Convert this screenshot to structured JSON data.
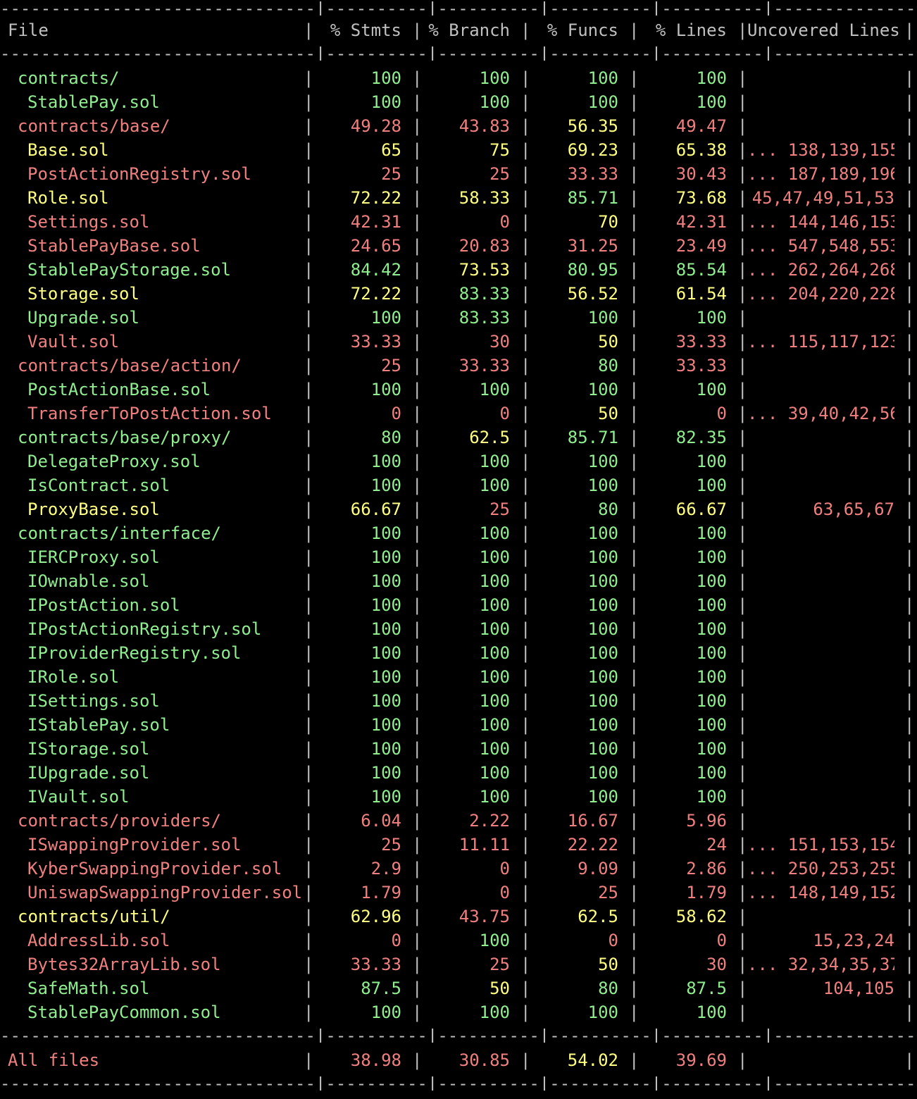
{
  "header": {
    "file": "File",
    "stmts": "% Stmts",
    "branch": "% Branch",
    "funcs": "% Funcs",
    "lines": "% Lines",
    "uncovered": "Uncovered Lines"
  },
  "separator_line": "-------------------------------|----------|----------|----------|----------|----------------|",
  "colors": {
    "green": "#90ee90",
    "red": "#f08080",
    "yellow": "#ffff80",
    "background": "#000000",
    "text": "#c0c0c0"
  },
  "rows": [
    {
      "name": "contracts/",
      "type": "dir",
      "file_color": "green",
      "stmts": "100",
      "stmts_color": "green",
      "branch": "100",
      "branch_color": "green",
      "funcs": "100",
      "funcs_color": "green",
      "lines": "100",
      "lines_color": "green",
      "uncovered": "",
      "uncovered_color": "red"
    },
    {
      "name": "StablePay.sol",
      "type": "file",
      "file_color": "green",
      "stmts": "100",
      "stmts_color": "green",
      "branch": "100",
      "branch_color": "green",
      "funcs": "100",
      "funcs_color": "green",
      "lines": "100",
      "lines_color": "green",
      "uncovered": "",
      "uncovered_color": "red"
    },
    {
      "name": "contracts/base/",
      "type": "dir",
      "file_color": "red",
      "stmts": "49.28",
      "stmts_color": "red",
      "branch": "43.83",
      "branch_color": "red",
      "funcs": "56.35",
      "funcs_color": "yellow",
      "lines": "49.47",
      "lines_color": "red",
      "uncovered": "",
      "uncovered_color": "red"
    },
    {
      "name": "Base.sol",
      "type": "file",
      "file_color": "yellow",
      "stmts": "65",
      "stmts_color": "yellow",
      "branch": "75",
      "branch_color": "yellow",
      "funcs": "69.23",
      "funcs_color": "yellow",
      "lines": "65.38",
      "lines_color": "yellow",
      "uncovered": "... 138,139,155",
      "uncovered_color": "red"
    },
    {
      "name": "PostActionRegistry.sol",
      "type": "file",
      "file_color": "red",
      "stmts": "25",
      "stmts_color": "red",
      "branch": "25",
      "branch_color": "red",
      "funcs": "33.33",
      "funcs_color": "red",
      "lines": "30.43",
      "lines_color": "red",
      "uncovered": "... 187,189,196",
      "uncovered_color": "red"
    },
    {
      "name": "Role.sol",
      "type": "file",
      "file_color": "yellow",
      "stmts": "72.22",
      "stmts_color": "yellow",
      "branch": "58.33",
      "branch_color": "yellow",
      "funcs": "85.71",
      "funcs_color": "green",
      "lines": "73.68",
      "lines_color": "yellow",
      "uncovered": "45,47,49,51,53",
      "uncovered_color": "red"
    },
    {
      "name": "Settings.sol",
      "type": "file",
      "file_color": "red",
      "stmts": "42.31",
      "stmts_color": "red",
      "branch": "0",
      "branch_color": "red",
      "funcs": "70",
      "funcs_color": "yellow",
      "lines": "42.31",
      "lines_color": "red",
      "uncovered": "... 144,146,153",
      "uncovered_color": "red"
    },
    {
      "name": "StablePayBase.sol",
      "type": "file",
      "file_color": "red",
      "stmts": "24.65",
      "stmts_color": "red",
      "branch": "20.83",
      "branch_color": "red",
      "funcs": "31.25",
      "funcs_color": "red",
      "lines": "23.49",
      "lines_color": "red",
      "uncovered": "... 547,548,553",
      "uncovered_color": "red"
    },
    {
      "name": "StablePayStorage.sol",
      "type": "file",
      "file_color": "green",
      "stmts": "84.42",
      "stmts_color": "green",
      "branch": "73.53",
      "branch_color": "yellow",
      "funcs": "80.95",
      "funcs_color": "green",
      "lines": "85.54",
      "lines_color": "green",
      "uncovered": "... 262,264,268",
      "uncovered_color": "red"
    },
    {
      "name": "Storage.sol",
      "type": "file",
      "file_color": "yellow",
      "stmts": "72.22",
      "stmts_color": "yellow",
      "branch": "83.33",
      "branch_color": "green",
      "funcs": "56.52",
      "funcs_color": "yellow",
      "lines": "61.54",
      "lines_color": "yellow",
      "uncovered": "... 204,220,228",
      "uncovered_color": "red"
    },
    {
      "name": "Upgrade.sol",
      "type": "file",
      "file_color": "green",
      "stmts": "100",
      "stmts_color": "green",
      "branch": "83.33",
      "branch_color": "green",
      "funcs": "100",
      "funcs_color": "green",
      "lines": "100",
      "lines_color": "green",
      "uncovered": "",
      "uncovered_color": "red"
    },
    {
      "name": "Vault.sol",
      "type": "file",
      "file_color": "red",
      "stmts": "33.33",
      "stmts_color": "red",
      "branch": "30",
      "branch_color": "red",
      "funcs": "50",
      "funcs_color": "yellow",
      "lines": "33.33",
      "lines_color": "red",
      "uncovered": "... 115,117,123",
      "uncovered_color": "red"
    },
    {
      "name": "contracts/base/action/",
      "type": "dir",
      "file_color": "red",
      "stmts": "25",
      "stmts_color": "red",
      "branch": "33.33",
      "branch_color": "red",
      "funcs": "80",
      "funcs_color": "green",
      "lines": "33.33",
      "lines_color": "red",
      "uncovered": "",
      "uncovered_color": "red"
    },
    {
      "name": "PostActionBase.sol",
      "type": "file",
      "file_color": "green",
      "stmts": "100",
      "stmts_color": "green",
      "branch": "100",
      "branch_color": "green",
      "funcs": "100",
      "funcs_color": "green",
      "lines": "100",
      "lines_color": "green",
      "uncovered": "",
      "uncovered_color": "red"
    },
    {
      "name": "TransferToPostAction.sol",
      "type": "file",
      "file_color": "red",
      "stmts": "0",
      "stmts_color": "red",
      "branch": "0",
      "branch_color": "red",
      "funcs": "50",
      "funcs_color": "yellow",
      "lines": "0",
      "lines_color": "red",
      "uncovered": "... 39,40,42,56",
      "uncovered_color": "red"
    },
    {
      "name": "contracts/base/proxy/",
      "type": "dir",
      "file_color": "green",
      "stmts": "80",
      "stmts_color": "green",
      "branch": "62.5",
      "branch_color": "yellow",
      "funcs": "85.71",
      "funcs_color": "green",
      "lines": "82.35",
      "lines_color": "green",
      "uncovered": "",
      "uncovered_color": "red"
    },
    {
      "name": "DelegateProxy.sol",
      "type": "file",
      "file_color": "green",
      "stmts": "100",
      "stmts_color": "green",
      "branch": "100",
      "branch_color": "green",
      "funcs": "100",
      "funcs_color": "green",
      "lines": "100",
      "lines_color": "green",
      "uncovered": "",
      "uncovered_color": "red"
    },
    {
      "name": "IsContract.sol",
      "type": "file",
      "file_color": "green",
      "stmts": "100",
      "stmts_color": "green",
      "branch": "100",
      "branch_color": "green",
      "funcs": "100",
      "funcs_color": "green",
      "lines": "100",
      "lines_color": "green",
      "uncovered": "",
      "uncovered_color": "red"
    },
    {
      "name": "ProxyBase.sol",
      "type": "file",
      "file_color": "yellow",
      "stmts": "66.67",
      "stmts_color": "yellow",
      "branch": "25",
      "branch_color": "red",
      "funcs": "80",
      "funcs_color": "green",
      "lines": "66.67",
      "lines_color": "yellow",
      "uncovered": "63,65,67",
      "uncovered_color": "red"
    },
    {
      "name": "contracts/interface/",
      "type": "dir",
      "file_color": "green",
      "stmts": "100",
      "stmts_color": "green",
      "branch": "100",
      "branch_color": "green",
      "funcs": "100",
      "funcs_color": "green",
      "lines": "100",
      "lines_color": "green",
      "uncovered": "",
      "uncovered_color": "red"
    },
    {
      "name": "IERCProxy.sol",
      "type": "file",
      "file_color": "green",
      "stmts": "100",
      "stmts_color": "green",
      "branch": "100",
      "branch_color": "green",
      "funcs": "100",
      "funcs_color": "green",
      "lines": "100",
      "lines_color": "green",
      "uncovered": "",
      "uncovered_color": "red"
    },
    {
      "name": "IOwnable.sol",
      "type": "file",
      "file_color": "green",
      "stmts": "100",
      "stmts_color": "green",
      "branch": "100",
      "branch_color": "green",
      "funcs": "100",
      "funcs_color": "green",
      "lines": "100",
      "lines_color": "green",
      "uncovered": "",
      "uncovered_color": "red"
    },
    {
      "name": "IPostAction.sol",
      "type": "file",
      "file_color": "green",
      "stmts": "100",
      "stmts_color": "green",
      "branch": "100",
      "branch_color": "green",
      "funcs": "100",
      "funcs_color": "green",
      "lines": "100",
      "lines_color": "green",
      "uncovered": "",
      "uncovered_color": "red"
    },
    {
      "name": "IPostActionRegistry.sol",
      "type": "file",
      "file_color": "green",
      "stmts": "100",
      "stmts_color": "green",
      "branch": "100",
      "branch_color": "green",
      "funcs": "100",
      "funcs_color": "green",
      "lines": "100",
      "lines_color": "green",
      "uncovered": "",
      "uncovered_color": "red"
    },
    {
      "name": "IProviderRegistry.sol",
      "type": "file",
      "file_color": "green",
      "stmts": "100",
      "stmts_color": "green",
      "branch": "100",
      "branch_color": "green",
      "funcs": "100",
      "funcs_color": "green",
      "lines": "100",
      "lines_color": "green",
      "uncovered": "",
      "uncovered_color": "red"
    },
    {
      "name": "IRole.sol",
      "type": "file",
      "file_color": "green",
      "stmts": "100",
      "stmts_color": "green",
      "branch": "100",
      "branch_color": "green",
      "funcs": "100",
      "funcs_color": "green",
      "lines": "100",
      "lines_color": "green",
      "uncovered": "",
      "uncovered_color": "red"
    },
    {
      "name": "ISettings.sol",
      "type": "file",
      "file_color": "green",
      "stmts": "100",
      "stmts_color": "green",
      "branch": "100",
      "branch_color": "green",
      "funcs": "100",
      "funcs_color": "green",
      "lines": "100",
      "lines_color": "green",
      "uncovered": "",
      "uncovered_color": "red"
    },
    {
      "name": "IStablePay.sol",
      "type": "file",
      "file_color": "green",
      "stmts": "100",
      "stmts_color": "green",
      "branch": "100",
      "branch_color": "green",
      "funcs": "100",
      "funcs_color": "green",
      "lines": "100",
      "lines_color": "green",
      "uncovered": "",
      "uncovered_color": "red"
    },
    {
      "name": "IStorage.sol",
      "type": "file",
      "file_color": "green",
      "stmts": "100",
      "stmts_color": "green",
      "branch": "100",
      "branch_color": "green",
      "funcs": "100",
      "funcs_color": "green",
      "lines": "100",
      "lines_color": "green",
      "uncovered": "",
      "uncovered_color": "red"
    },
    {
      "name": "IUpgrade.sol",
      "type": "file",
      "file_color": "green",
      "stmts": "100",
      "stmts_color": "green",
      "branch": "100",
      "branch_color": "green",
      "funcs": "100",
      "funcs_color": "green",
      "lines": "100",
      "lines_color": "green",
      "uncovered": "",
      "uncovered_color": "red"
    },
    {
      "name": "IVault.sol",
      "type": "file",
      "file_color": "green",
      "stmts": "100",
      "stmts_color": "green",
      "branch": "100",
      "branch_color": "green",
      "funcs": "100",
      "funcs_color": "green",
      "lines": "100",
      "lines_color": "green",
      "uncovered": "",
      "uncovered_color": "red"
    },
    {
      "name": "contracts/providers/",
      "type": "dir",
      "file_color": "red",
      "stmts": "6.04",
      "stmts_color": "red",
      "branch": "2.22",
      "branch_color": "red",
      "funcs": "16.67",
      "funcs_color": "red",
      "lines": "5.96",
      "lines_color": "red",
      "uncovered": "",
      "uncovered_color": "red"
    },
    {
      "name": "ISwappingProvider.sol",
      "type": "file",
      "file_color": "red",
      "stmts": "25",
      "stmts_color": "red",
      "branch": "11.11",
      "branch_color": "red",
      "funcs": "22.22",
      "funcs_color": "red",
      "lines": "24",
      "lines_color": "red",
      "uncovered": "... 151,153,154",
      "uncovered_color": "red"
    },
    {
      "name": "KyberSwappingProvider.sol",
      "type": "file",
      "file_color": "red",
      "stmts": "2.9",
      "stmts_color": "red",
      "branch": "0",
      "branch_color": "red",
      "funcs": "9.09",
      "funcs_color": "red",
      "lines": "2.86",
      "lines_color": "red",
      "uncovered": "... 250,253,255",
      "uncovered_color": "red"
    },
    {
      "name": "UniswapSwappingProvider.sol",
      "type": "file",
      "file_color": "red",
      "stmts": "1.79",
      "stmts_color": "red",
      "branch": "0",
      "branch_color": "red",
      "funcs": "25",
      "funcs_color": "red",
      "lines": "1.79",
      "lines_color": "red",
      "uncovered": "... 148,149,152",
      "uncovered_color": "red"
    },
    {
      "name": "contracts/util/",
      "type": "dir",
      "file_color": "yellow",
      "stmts": "62.96",
      "stmts_color": "yellow",
      "branch": "43.75",
      "branch_color": "red",
      "funcs": "62.5",
      "funcs_color": "yellow",
      "lines": "58.62",
      "lines_color": "yellow",
      "uncovered": "",
      "uncovered_color": "red"
    },
    {
      "name": "AddressLib.sol",
      "type": "file",
      "file_color": "red",
      "stmts": "0",
      "stmts_color": "red",
      "branch": "100",
      "branch_color": "green",
      "funcs": "0",
      "funcs_color": "red",
      "lines": "0",
      "lines_color": "red",
      "uncovered": "15,23,24",
      "uncovered_color": "red"
    },
    {
      "name": "Bytes32ArrayLib.sol",
      "type": "file",
      "file_color": "red",
      "stmts": "33.33",
      "stmts_color": "red",
      "branch": "25",
      "branch_color": "red",
      "funcs": "50",
      "funcs_color": "yellow",
      "lines": "30",
      "lines_color": "red",
      "uncovered": "... 32,34,35,37",
      "uncovered_color": "red"
    },
    {
      "name": "SafeMath.sol",
      "type": "file",
      "file_color": "green",
      "stmts": "87.5",
      "stmts_color": "green",
      "branch": "50",
      "branch_color": "yellow",
      "funcs": "80",
      "funcs_color": "green",
      "lines": "87.5",
      "lines_color": "green",
      "uncovered": "104,105",
      "uncovered_color": "red"
    },
    {
      "name": "StablePayCommon.sol",
      "type": "file",
      "file_color": "green",
      "stmts": "100",
      "stmts_color": "green",
      "branch": "100",
      "branch_color": "green",
      "funcs": "100",
      "funcs_color": "green",
      "lines": "100",
      "lines_color": "green",
      "uncovered": "",
      "uncovered_color": "red"
    }
  ],
  "total": {
    "name": "All files",
    "file_color": "red",
    "stmts": "38.98",
    "stmts_color": "red",
    "branch": "30.85",
    "branch_color": "red",
    "funcs": "54.02",
    "funcs_color": "yellow",
    "lines": "39.69",
    "lines_color": "red",
    "uncovered": ""
  }
}
